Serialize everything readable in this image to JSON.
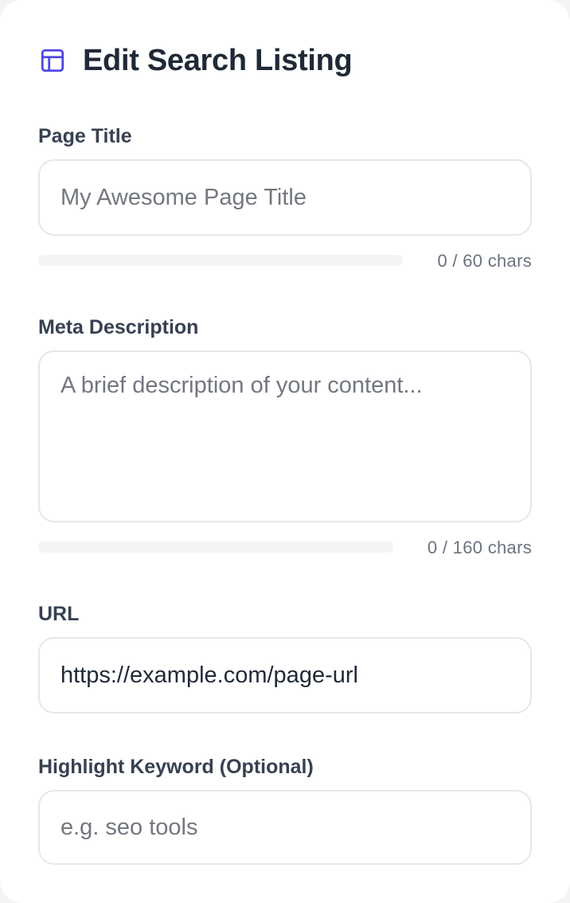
{
  "header": {
    "icon": "layout-icon",
    "title": "Edit Search Listing",
    "accent_color": "#4f46e5"
  },
  "page_title": {
    "label": "Page Title",
    "value": "",
    "placeholder": "My Awesome Page Title",
    "progress_fraction": 0,
    "counter": "0 / 60 chars"
  },
  "meta_description": {
    "label": "Meta Description",
    "value": "",
    "placeholder": "A brief description of your content...",
    "progress_fraction": 0,
    "counter": "0 / 160 chars"
  },
  "url": {
    "label": "URL",
    "value": "https://example.com/page-url"
  },
  "highlight_keyword": {
    "label": "Highlight Keyword (Optional)",
    "value": "",
    "placeholder": "e.g. seo tools"
  }
}
